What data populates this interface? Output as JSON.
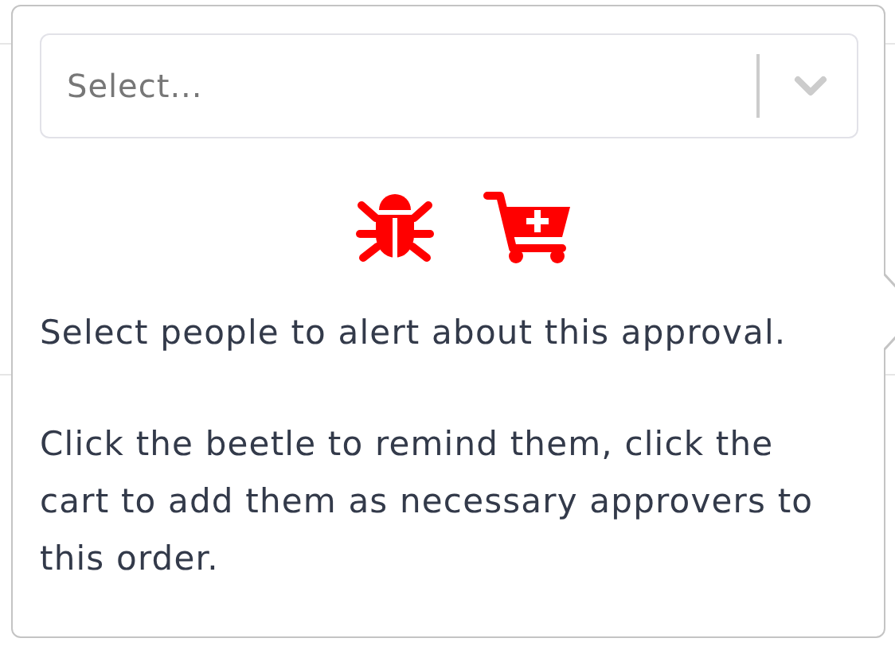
{
  "select": {
    "placeholder": "Select..."
  },
  "actions": [
    {
      "kind": "bug"
    },
    {
      "kind": "cart"
    }
  ],
  "paragraphs": [
    "Select people to alert about this approval.",
    "Click the beetle to remind them, click the cart to add them as necessary approvers to this order."
  ]
}
